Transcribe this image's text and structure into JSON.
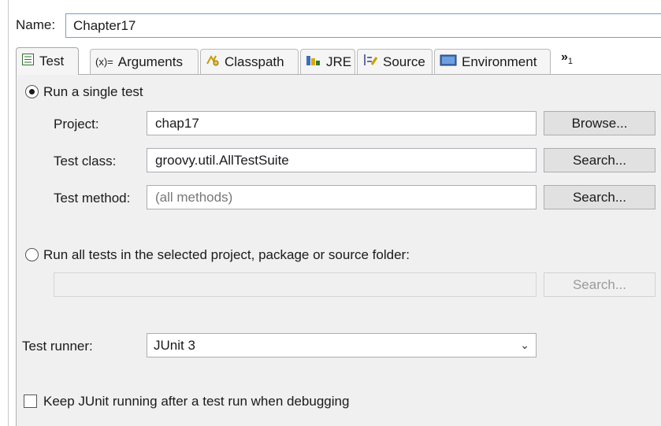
{
  "name": {
    "label": "Name:",
    "value": "Chapter17"
  },
  "tabs": [
    {
      "label": "Test",
      "icon": "test-icon",
      "active": true
    },
    {
      "label": "Arguments",
      "icon": "arguments-icon",
      "prefix": "(x)="
    },
    {
      "label": "Classpath",
      "icon": "classpath-icon"
    },
    {
      "label": "JRE",
      "icon": "jre-icon"
    },
    {
      "label": "Source",
      "icon": "source-icon"
    },
    {
      "label": "Environment",
      "icon": "environment-icon"
    }
  ],
  "tab_overflow": {
    "glyph": "»",
    "count": "1"
  },
  "single_test": {
    "label": "Run a single test",
    "project": {
      "label": "Project:",
      "value": "chap17",
      "button": "Browse..."
    },
    "test_class": {
      "label": "Test class:",
      "value": "groovy.util.AllTestSuite",
      "button": "Search..."
    },
    "test_method": {
      "label": "Test method:",
      "placeholder": "(all methods)",
      "button": "Search..."
    }
  },
  "all_tests": {
    "label": "Run all tests in the selected project, package or source folder:",
    "value": "",
    "button": "Search..."
  },
  "test_runner": {
    "label": "Test runner:",
    "value": "JUnit 3"
  },
  "keep_running": {
    "label": "Keep JUnit running after a test run when debugging",
    "checked": false
  }
}
